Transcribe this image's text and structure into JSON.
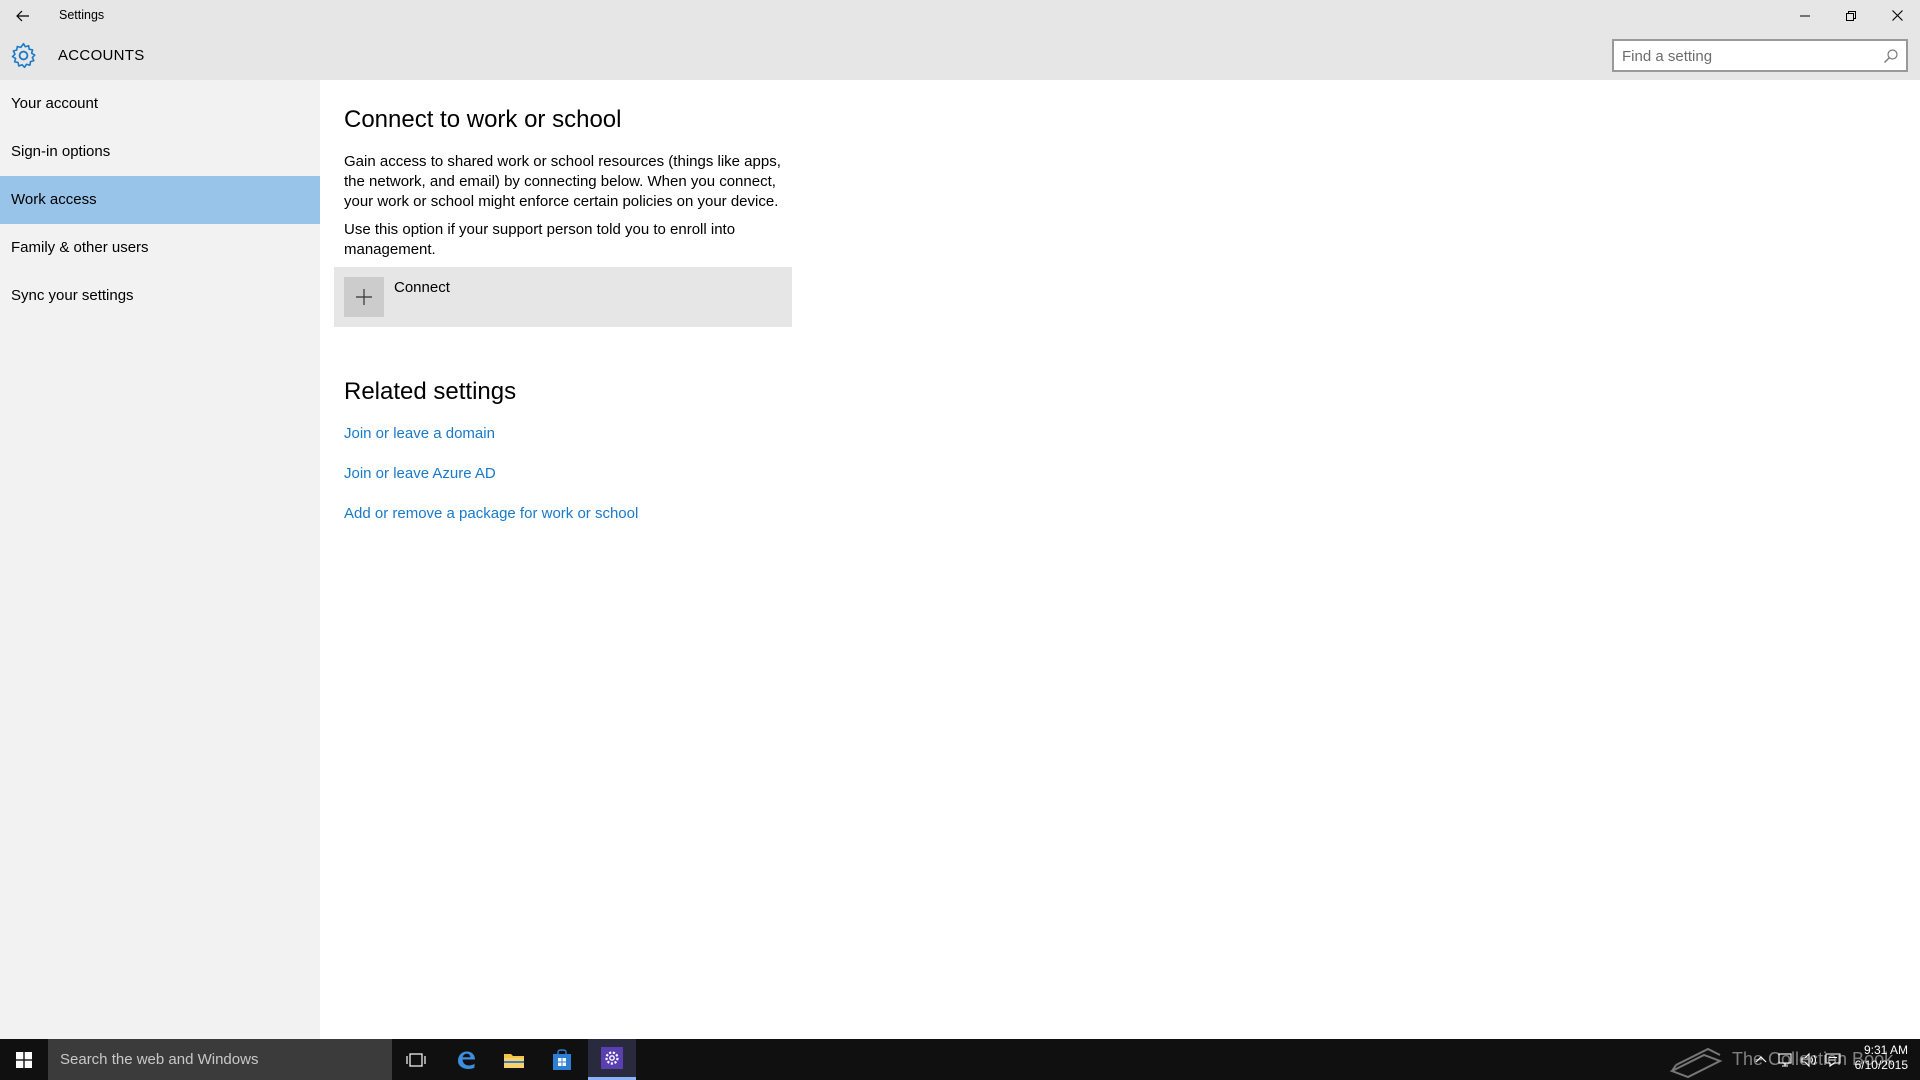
{
  "window": {
    "title": "Settings"
  },
  "header": {
    "title": "ACCOUNTS",
    "search_placeholder": "Find a setting"
  },
  "sidebar": {
    "items": [
      {
        "label": "Your account"
      },
      {
        "label": "Sign-in options"
      },
      {
        "label": "Work access",
        "selected": true
      },
      {
        "label": "Family & other users"
      },
      {
        "label": "Sync your settings"
      }
    ]
  },
  "main": {
    "heading": "Connect to work or school",
    "description": "Gain access to shared work or school resources (things like apps, the network, and email) by connecting below. When you connect, your work or school might enforce certain policies on your device.",
    "enroll_note": "Use this option if your support person told you to enroll into management.",
    "connect_label": "Connect",
    "related_heading": "Related settings",
    "links": [
      {
        "label": "Join or leave a domain"
      },
      {
        "label": "Join or leave Azure AD"
      },
      {
        "label": "Add or remove a package for work or school"
      }
    ]
  },
  "taskbar": {
    "search_placeholder": "Search the web and Windows",
    "time": "9:31 AM",
    "date": "6/10/2015",
    "watermark": "The Collection Book"
  },
  "colors": {
    "accent": "#1979ca",
    "selected_nav": "#99c4ea",
    "chrome": "#e6e6e6",
    "sidebar": "#f2f2f2",
    "taskbar": "#101010"
  }
}
